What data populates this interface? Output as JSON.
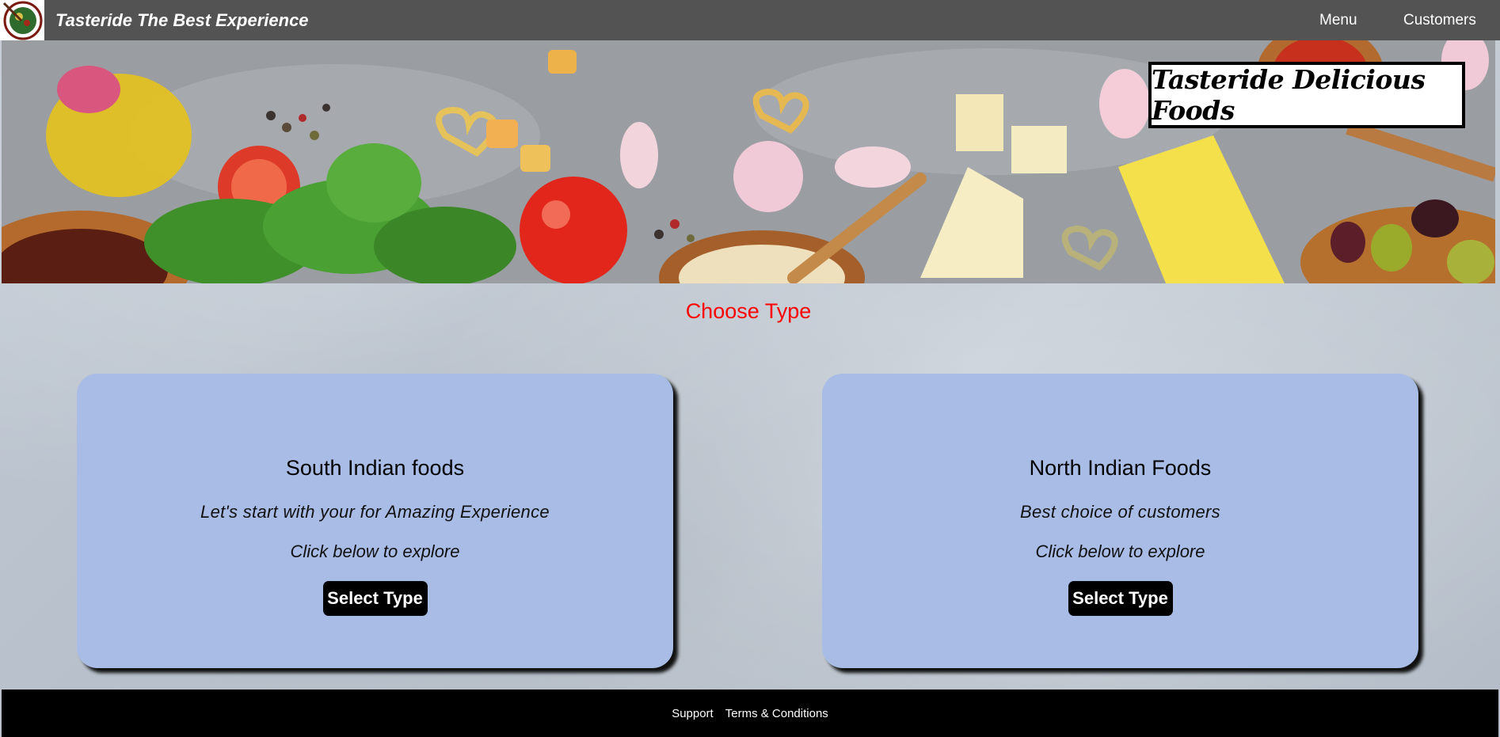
{
  "nav": {
    "brand": "Tasteride The Best Experience",
    "links": [
      {
        "label": "Menu"
      },
      {
        "label": "Customers"
      }
    ],
    "logo_icon": "food-plate-logo-icon"
  },
  "hero": {
    "title": "Tasteride Delicious Foods",
    "image": "food-ingredients-banner"
  },
  "section": {
    "title": "Choose Type"
  },
  "cards": [
    {
      "title": "South Indian foods",
      "description": "Let's start with your for Amazing Experience",
      "hint": "Click below to explore",
      "button": "Select Type"
    },
    {
      "title": "North Indian Foods",
      "description": "Best choice of customers",
      "hint": "Click below to explore",
      "button": "Select Type"
    }
  ],
  "footer": {
    "links": [
      {
        "label": "Support"
      },
      {
        "label": "Terms & Conditions"
      }
    ]
  },
  "colors": {
    "navbar": "#535353",
    "section_title": "#ff0000",
    "card_bg": "#a8bce6",
    "button_bg": "#000000",
    "footer_bg": "#000000"
  }
}
